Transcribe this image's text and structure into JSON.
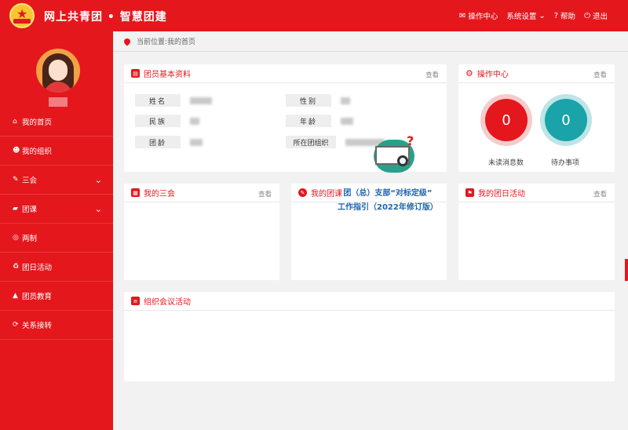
{
  "header": {
    "title": "网上共青团 • 智慧团建",
    "nav": [
      {
        "label": "操作中心",
        "icon": "envelope-icon"
      },
      {
        "label": "系统设置",
        "icon": "chevron-down-icon"
      },
      {
        "label": "帮助",
        "icon": "help-icon"
      },
      {
        "label": "退出",
        "icon": "power-icon"
      }
    ]
  },
  "sidebar": {
    "items": [
      {
        "label": "我的首页",
        "icon": "home-icon"
      },
      {
        "label": "我的组织",
        "icon": "users-icon"
      },
      {
        "label": "三会",
        "icon": "edit-icon",
        "chevron": "❯"
      },
      {
        "label": "团课",
        "icon": "folder-icon",
        "chevron": "❯"
      },
      {
        "label": "两制",
        "icon": "target-icon"
      },
      {
        "label": "团日活动",
        "icon": "recycle-icon"
      },
      {
        "label": "团员教育",
        "icon": "graduation-cap-icon"
      },
      {
        "label": "关系接转",
        "icon": "refresh-icon"
      }
    ]
  },
  "breadcrumb": {
    "text": "当前位置:我的首页"
  },
  "profile_card": {
    "title": "团员基本资料",
    "more": "查看",
    "fields": {
      "name": "姓名",
      "gender": "性别",
      "ethnicity": "民族",
      "age": "年龄",
      "league_age": "团龄",
      "org": "所在团组织"
    }
  },
  "ops_card": {
    "title": "操作中心",
    "more": "查看",
    "unread_count": "0",
    "unread_label": "未读消息数",
    "todo_count": "0",
    "todo_label": "待办事项"
  },
  "cards": {
    "sanhui": {
      "title": "我的三会",
      "more": "查看"
    },
    "tuanke": {
      "title": "我的团课"
    },
    "tuanri": {
      "title": "我的团日活动",
      "more": "查看"
    },
    "meeting": {
      "title": "组织会议活动"
    }
  },
  "promo": {
    "line1": "团（总）支部“对标定级”",
    "line2": "工作指引（2022年修订版）"
  },
  "colors": {
    "brand_red": "#e4171d",
    "teal": "#1aa3a8",
    "promo_blue": "#1d64b0"
  }
}
